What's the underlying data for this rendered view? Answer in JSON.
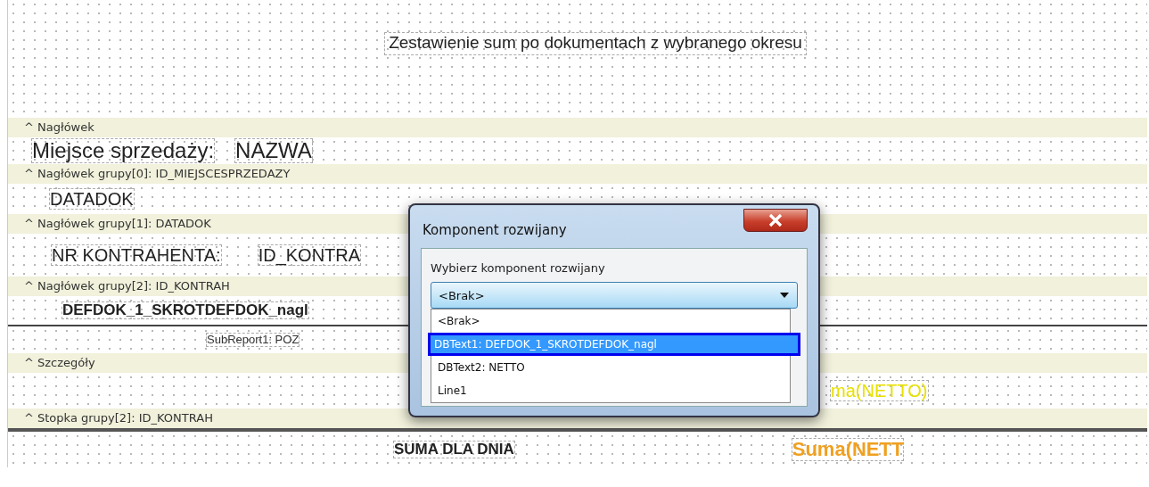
{
  "report_title": "Zestawienie sum po dokumentach z wybranego okresu",
  "bands": [
    {
      "header": "^ Nagłówek",
      "rows": [
        {
          "items": [
            {
              "kind": "big",
              "text": "Miejsce sprzedaży:"
            },
            {
              "kind": "big",
              "text": "NAZWA"
            }
          ]
        }
      ]
    },
    {
      "header": "^ Nagłówek grupy[0]: ID_MIEJSCESPRZEDAZY",
      "rows": [
        {
          "items": [
            {
              "kind": "medium",
              "text": "DATADOK"
            }
          ]
        }
      ]
    },
    {
      "header": "^ Nagłówek grupy[1]: DATADOK",
      "rows": [
        {
          "items": [
            {
              "kind": "medium",
              "text": "NR KONTRAHENTA:"
            },
            {
              "kind": "medium",
              "text": "ID_KONTRA"
            }
          ]
        }
      ]
    },
    {
      "header": "^ Nagłówek grupy[2]: ID_KONTRAH",
      "rows": [
        {
          "line_below": true,
          "items": [
            {
              "kind": "bold",
              "text": "DEFDOK_1_SKROTDEFDOK_nagl"
            }
          ]
        },
        {
          "items": [
            {
              "kind": "subreport",
              "text": "SubReport1: POZ"
            }
          ]
        }
      ]
    },
    {
      "header": "^ Szczegóły",
      "rows": [
        {
          "items": [
            {
              "kind": "yellow",
              "text": "ma(NETTO)"
            }
          ]
        }
      ]
    },
    {
      "header": "^ Stopka grupy[2]: ID_KONTRAH",
      "rows": [
        {
          "line_above": true,
          "items": [
            {
              "kind": "bold",
              "text": "SUMA DLA DNIA"
            },
            {
              "kind": "orange",
              "text": "Suma(NETT"
            }
          ]
        }
      ]
    }
  ],
  "dialog": {
    "title": "Komponent rozwijany",
    "label": "Wybierz komponent rozwijany",
    "combo_value": "<Brak>",
    "options": [
      {
        "text": "<Brak>",
        "selected": false
      },
      {
        "text": "DBText1: DEFDOK_1_SKROTDEFDOK_nagl",
        "selected": true
      },
      {
        "text": "DBText2: NETTO",
        "selected": false
      },
      {
        "text": "Line1",
        "selected": false
      }
    ]
  }
}
